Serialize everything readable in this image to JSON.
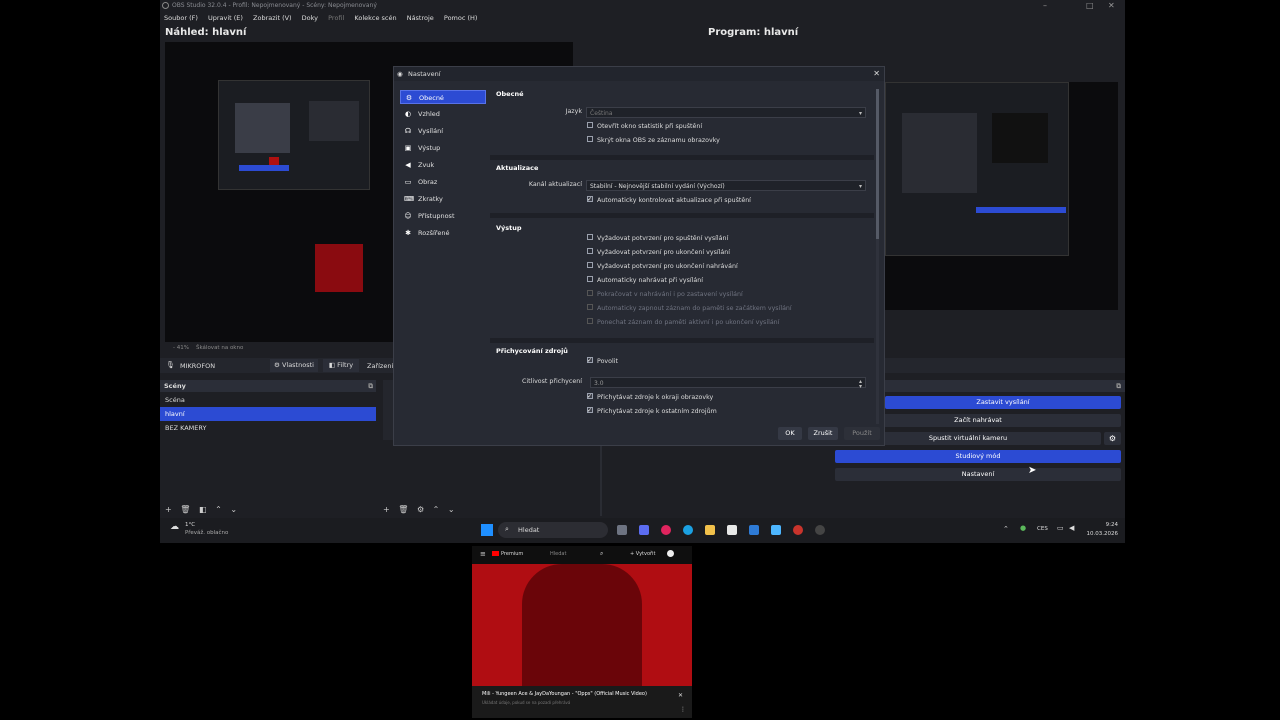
{
  "window": {
    "title": "OBS Studio 32.0.4 - Profil: Nepojmenovaný - Scény: Nepojmenovaný",
    "controls": [
      "–",
      "□",
      "✕"
    ]
  },
  "menu": [
    "Soubor (F)",
    "Upravit (E)",
    "Zobrazit (V)",
    "Doky",
    "Profil",
    "Kolekce scén",
    "Nástroje",
    "Pomoc (H)"
  ],
  "preview": {
    "title": "Náhled: hlavní",
    "zoom": "- 41%",
    "scale_label": "Škálovat na okno"
  },
  "program": {
    "title": "Program: hlavní"
  },
  "source_bar": {
    "source_name": "MIKROFON",
    "properties": "Vlastnosti",
    "filters": "Filtry",
    "device": "Zařízení"
  },
  "scenes": {
    "title": "Scény",
    "items": [
      "Scéna",
      "hlavní",
      "BEZ KAMERY"
    ],
    "selected_index": 1
  },
  "controls": {
    "stop_stream": "Zastavit vysílání",
    "start_record": "Začít nahrávat",
    "virtual_cam": "Spustit virtuální kameru",
    "studio_mode": "Studiový mód",
    "settings": "Nastavení"
  },
  "dialog": {
    "title": "Nastavení",
    "nav": [
      {
        "label": "Obecné",
        "icon": "gear-icon",
        "glyph": "⚙"
      },
      {
        "label": "Vzhled",
        "icon": "palette-icon",
        "glyph": "◐"
      },
      {
        "label": "Vysílání",
        "icon": "broadcast-icon",
        "glyph": "((·))"
      },
      {
        "label": "Výstup",
        "icon": "output-icon",
        "glyph": "▣"
      },
      {
        "label": "Zvuk",
        "icon": "speaker-icon",
        "glyph": "🔊"
      },
      {
        "label": "Obraz",
        "icon": "monitor-icon",
        "glyph": "▭"
      },
      {
        "label": "Zkratky",
        "icon": "keyboard-icon",
        "glyph": "⌨"
      },
      {
        "label": "Přístupnost",
        "icon": "accessibility-icon",
        "glyph": "♿"
      },
      {
        "label": "Rozšířené",
        "icon": "wrench-icon",
        "glyph": "✱"
      }
    ],
    "selected_nav": 0,
    "general": {
      "header": "Obecné",
      "language_label": "Jazyk",
      "language_value": "Čeština",
      "checks": [
        {
          "label": "Otevřít okno statistik při spuštění",
          "checked": false
        },
        {
          "label": "Skrýt okna OBS ze záznamu obrazovky",
          "checked": false
        }
      ]
    },
    "updates": {
      "header": "Aktualizace",
      "channel_label": "Kanál aktualizací",
      "channel_value": "Stabilní - Nejnovější stabilní vydání (Výchozí)",
      "auto_check": {
        "label": "Automaticky kontrolovat aktualizace při spuštění",
        "checked": true
      }
    },
    "output": {
      "header": "Výstup",
      "checks": [
        {
          "label": "Vyžadovat potvrzení pro spuštění vysílání",
          "checked": false,
          "disabled": false
        },
        {
          "label": "Vyžadovat potvrzení pro ukončení vysílání",
          "checked": false,
          "disabled": false
        },
        {
          "label": "Vyžadovat potvrzení pro ukončení nahrávání",
          "checked": false,
          "disabled": false
        },
        {
          "label": "Automaticky nahrávat při vysílání",
          "checked": false,
          "disabled": false
        },
        {
          "label": "Pokračovat v nahrávání i po zastavení vysílání",
          "checked": false,
          "disabled": true
        },
        {
          "label": "Automaticky zapnout záznam do paměti se začátkem vysílání",
          "checked": false,
          "disabled": true
        },
        {
          "label": "Ponechat záznam do paměti aktivní i po ukončení vysílání",
          "checked": false,
          "disabled": true
        }
      ]
    },
    "snapping": {
      "header": "Přichycování zdrojů",
      "enable": {
        "label": "Povolit",
        "checked": true
      },
      "sensitivity_label": "Citlivost přichycení",
      "sensitivity_value": "3.0",
      "checks": [
        {
          "label": "Přichytávat zdroje k okraji obrazovky",
          "checked": true
        },
        {
          "label": "Přichytávat zdroje k ostatním zdrojům",
          "checked": true
        }
      ]
    },
    "buttons": {
      "ok": "OK",
      "cancel": "Zrušit",
      "apply": "Použít"
    }
  },
  "taskbar": {
    "weather_temp": "1°C",
    "weather_desc": "Převáž. oblačno",
    "search_placeholder": "Hledat",
    "lang": "CES",
    "time": "9:24",
    "date": "10.03.2026"
  },
  "popup": {
    "brand": "Premium",
    "search_hint": "Hledat",
    "create": "+ Vytvořit",
    "video_title": "Mili - Yungeen Ace & JayDaYoungan - \"Opps\" (Official Music Video)",
    "subtitle": "Ukládat údaje, pokud se na pozadí přehrává"
  },
  "colors": {
    "accent": "#2c4bd3",
    "bg": "#1e1f24",
    "panel": "#2b2e38"
  }
}
